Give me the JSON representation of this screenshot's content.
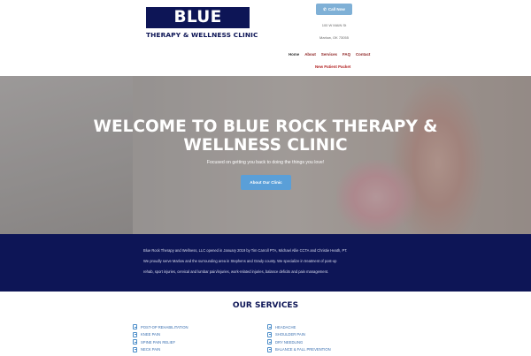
{
  "header": {
    "logo_title": "BLUE ROCK",
    "logo_subtitle": "THERAPY & WELLNESS CLINIC",
    "call_button": "Call Now",
    "address_line1": "100 W MAIN St",
    "address_line2": "Marlow, OK 73055",
    "nav": [
      "Home",
      "About",
      "Services",
      "FAQ",
      "Contact"
    ],
    "portal_link": "New Patient Packet"
  },
  "hero": {
    "title": "WELCOME TO BLUE ROCK THERAPY & WELLNESS CLINIC",
    "subtitle": "Focused on getting you back to doing the things you love!",
    "button": "About Our Clinic"
  },
  "info": {
    "line1": "Blue Rock Therapy and Wellness, LLC opened in January 2019 by Tim Carroll PTA, Michael Allie CCTA and Christie Heath, PT.",
    "line2": "We proudly serve Marlow and the surrounding area in Stephens and Grady county. We specialize in treatment of post-op",
    "line3": "rehab, sport injuries, cervical and lumbar pain/injuries, work-related injuries, balance deficits and pain management."
  },
  "services": {
    "title": "OUR SERVICES",
    "left": [
      "POST-OP REHABILITATION",
      "KNEE PAIN",
      "SPINE PAIN RELIEF",
      "NECK PAIN"
    ],
    "right": [
      "HEADACHE",
      "SHOULDER PAIN",
      "DRY NEEDLING",
      "BALANCE & FALL PREVENTION"
    ]
  },
  "colors": {
    "navy": "#0d1556",
    "button_blue": "#5a9fd8",
    "nav_red": "#8a1c1c"
  }
}
